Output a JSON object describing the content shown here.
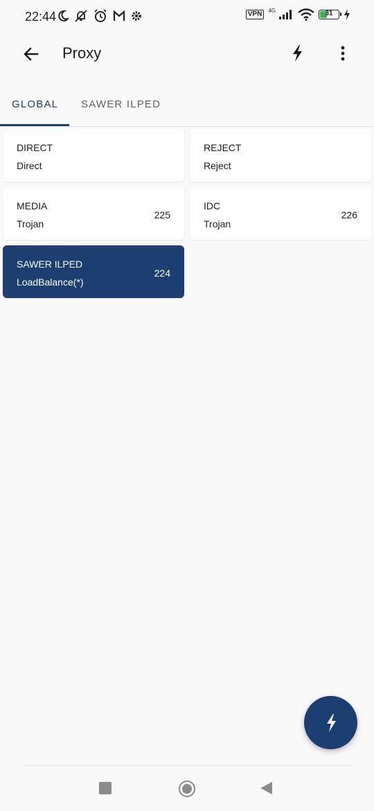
{
  "status_bar": {
    "time": "22:44",
    "vpn": "VPN",
    "network": "4G",
    "battery": "31"
  },
  "app_bar": {
    "title": "Proxy"
  },
  "tabs": [
    {
      "label": "GLOBAL",
      "active": true
    },
    {
      "label": "SAWER ILPED",
      "active": false
    }
  ],
  "proxies": [
    {
      "name": "DIRECT",
      "type": "Direct",
      "delay": ""
    },
    {
      "name": "REJECT",
      "type": "Reject",
      "delay": ""
    },
    {
      "name": "MEDIA",
      "type": "Trojan",
      "delay": "225"
    },
    {
      "name": "IDC",
      "type": "Trojan",
      "delay": "226"
    },
    {
      "name": "SAWER ILPED",
      "type": "LoadBalance(*)",
      "delay": "224",
      "selected": true
    }
  ],
  "colors": {
    "primary": "#1d3e70",
    "background": "#f9f9fa",
    "card": "#ffffff"
  },
  "icons": {
    "back": "arrow-left-icon",
    "test": "lightning-bolt-icon",
    "more": "more-vert-icon",
    "fab": "lightning-bolt-icon"
  }
}
